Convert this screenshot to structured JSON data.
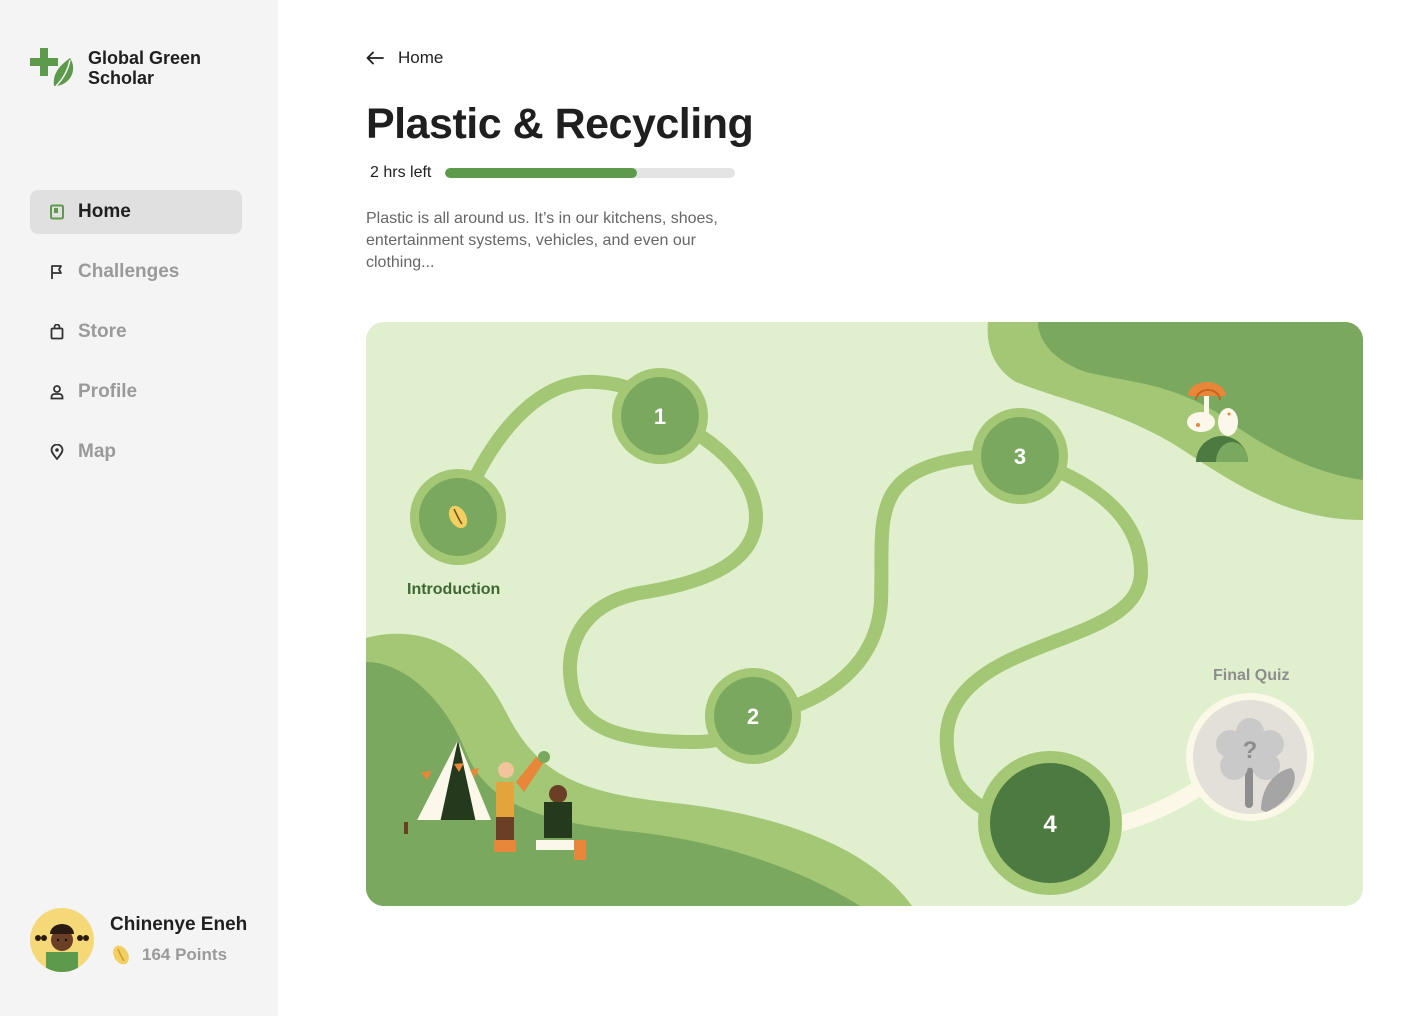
{
  "brand": {
    "name": "Global Green Scholar",
    "logo_icon": "leaf-cross-logo",
    "accent": "#5e9a4c"
  },
  "nav": {
    "items": [
      {
        "label": "Home",
        "icon": "book-icon",
        "active": true
      },
      {
        "label": "Challenges",
        "icon": "flag-icon",
        "active": false
      },
      {
        "label": "Store",
        "icon": "bag-icon",
        "active": false
      },
      {
        "label": "Profile",
        "icon": "person-icon",
        "active": false
      },
      {
        "label": "Map",
        "icon": "pin-icon",
        "active": false
      }
    ]
  },
  "user": {
    "name": "Chinenye Eneh",
    "points": "164 Points",
    "points_icon": "seed-icon"
  },
  "page": {
    "back_label": "Home",
    "title": "Plastic & Recycling",
    "time_left": "2 hrs left",
    "progress": 0.66,
    "description": "Plastic is all around us. It’s in our kitchens, shoes, entertainment systems, vehicles, and even our clothing..."
  },
  "map": {
    "intro_label": "Introduction",
    "final_label": "Final Quiz",
    "final_icon": "question-flower-icon",
    "steps": [
      "1",
      "2",
      "3",
      "4"
    ],
    "colors": {
      "background": "#e0efcd",
      "path": "#a3c774",
      "node": "#7aa85e",
      "current": "#4d7a40",
      "hill": "#7aa85e"
    }
  }
}
